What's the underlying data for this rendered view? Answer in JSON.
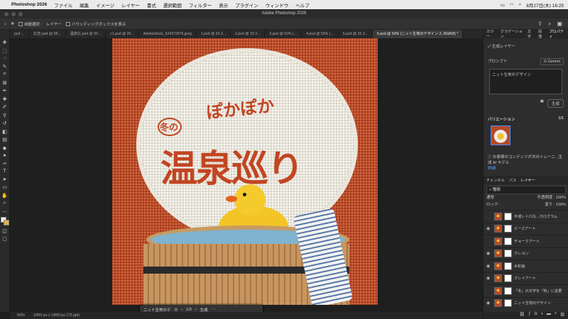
{
  "menubar": {
    "app": "Photoshop 2026",
    "items": [
      "ファイル",
      "編集",
      "イメージ",
      "レイヤー",
      "書式",
      "選択範囲",
      "フィルター",
      "表示",
      "プラグイン",
      "ウィンドウ",
      "ヘルプ"
    ],
    "datetime": "8月27日(木) 16:25"
  },
  "window_title": "Adobe Photoshop 2026",
  "options": {
    "auto_select_label": "自動選択 :",
    "auto_select_value": "レイヤー",
    "bbox_label": "バウンディングボックスを表示"
  },
  "doc_tabs": [
    "psd ...",
    "広告.psd @ 58...",
    "温泉広.psd @ 50...",
    "c1.psd @ 26...",
    "AdobeStock_524372876.jpeg",
    "1.psd @ 33.3...",
    "2.psd @ 33.3...",
    "3.psd @ 50% (...",
    "4.psd @ 50% (...",
    "5.psd @ 33.3...",
    "6.psd @ 50% (ニット生地のデザイン 2, RGB/8) *"
  ],
  "artwork": {
    "title_small": "ぽかぽか",
    "title_badge": "冬の",
    "title_main": "温泉巡り"
  },
  "status": {
    "zoom": "50%",
    "size": "1800 px x 1800 px (72 ppi)"
  },
  "taskbar": {
    "layer_name": "ニット生地のデ",
    "page": "1/3",
    "generate": "生成"
  },
  "panel": {
    "top_tabs": [
      "カラー",
      "グラデーション",
      "文字",
      "段落",
      "プロパティ"
    ],
    "gen_layer_label": "生成レイヤー",
    "prompt_label": "プロンプト",
    "model": "Gemini",
    "prompt_text": "ニット生地のデザイン",
    "generate": "生成",
    "variations_label": "バリエーション",
    "variations_count": "1/1",
    "notice": "お客様のコンテンツが次のトレーニ...生成 AI モデル",
    "notice_link": "詳細",
    "layer_tabs": [
      "チャンネル",
      "パス",
      "レイヤー"
    ],
    "kind": "種類",
    "blend": "通常",
    "opacity_label": "不透明度 :",
    "opacity": "100%",
    "lock_label": "ロック :",
    "fill_label": "塗り :",
    "fill": "100%",
    "layers": [
      "平成レトロな...ホログラム",
      "ビーズアート",
      "チョークアート",
      "クレヨン",
      "水彩画",
      "クレイアート",
      "「冬」の文字を「秋」に変更",
      "ニット生地のデザイン"
    ]
  }
}
